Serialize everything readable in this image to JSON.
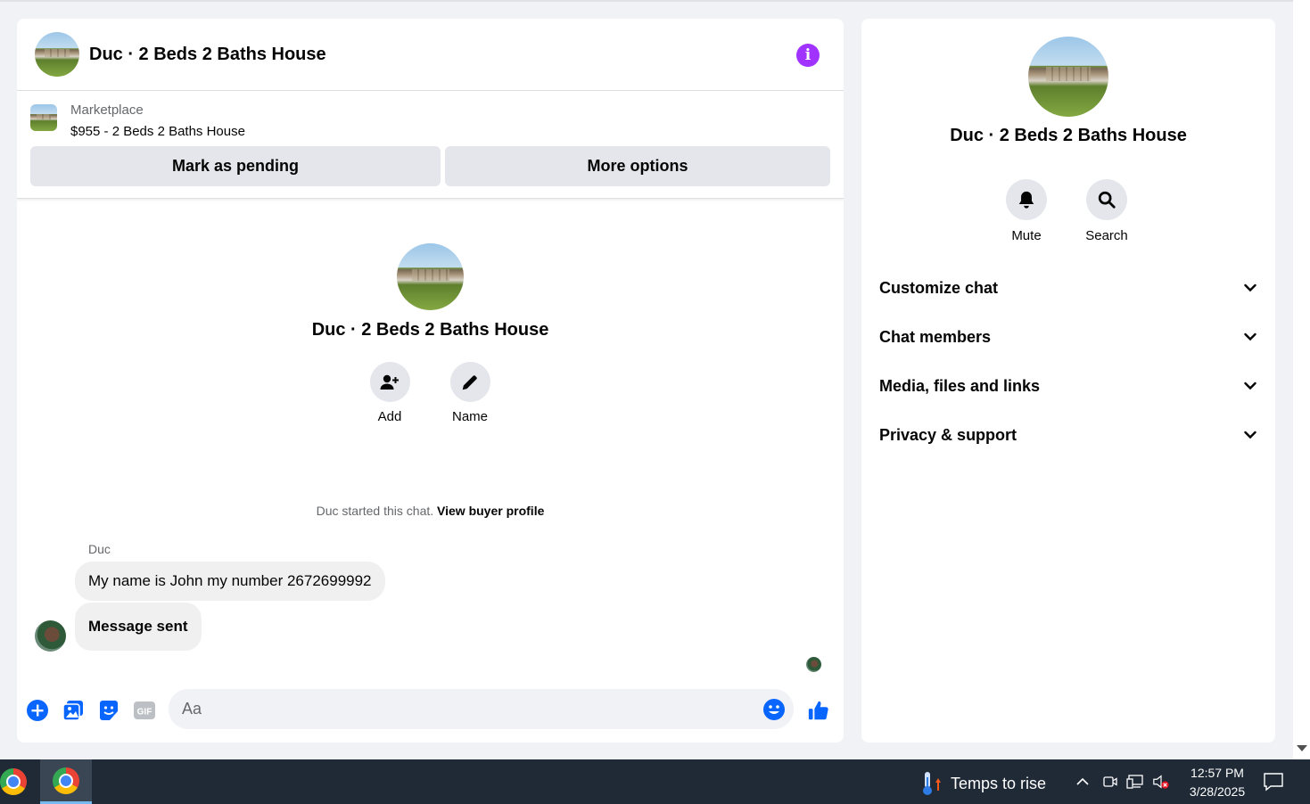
{
  "chat": {
    "header_title": "Duc · 2 Beds 2 Baths House",
    "marketplace_label": "Marketplace",
    "listing_title": "$955 - 2 Beds 2 Baths House",
    "mark_pending_label": "Mark as pending",
    "more_options_label": "More options",
    "intro_title": "Duc · 2 Beds 2 Baths House",
    "intro_actions": [
      {
        "label": "Add",
        "icon": "add-person-icon"
      },
      {
        "label": "Name",
        "icon": "pencil-icon"
      }
    ],
    "started_text": "Duc started this chat.",
    "view_profile_label": "View buyer profile",
    "sender_name": "Duc",
    "messages": [
      {
        "text": "My name is John my number 2672699992"
      },
      {
        "text": "Message sent"
      }
    ],
    "composer_placeholder": "Aa"
  },
  "side_panel": {
    "title": "Duc · 2 Beds 2 Baths House",
    "actions": [
      {
        "label": "Mute",
        "icon": "bell-icon"
      },
      {
        "label": "Search",
        "icon": "search-icon"
      }
    ],
    "sections": [
      {
        "label": "Customize chat"
      },
      {
        "label": "Chat members"
      },
      {
        "label": "Media, files and links"
      },
      {
        "label": "Privacy & support"
      }
    ]
  },
  "taskbar": {
    "weather_text": "Temps to rise",
    "time": "12:57 PM",
    "date": "3/28/2025"
  },
  "colors": {
    "accent": "#0866ff",
    "info": "#a033ff",
    "taskbar": "#1f2a36"
  }
}
